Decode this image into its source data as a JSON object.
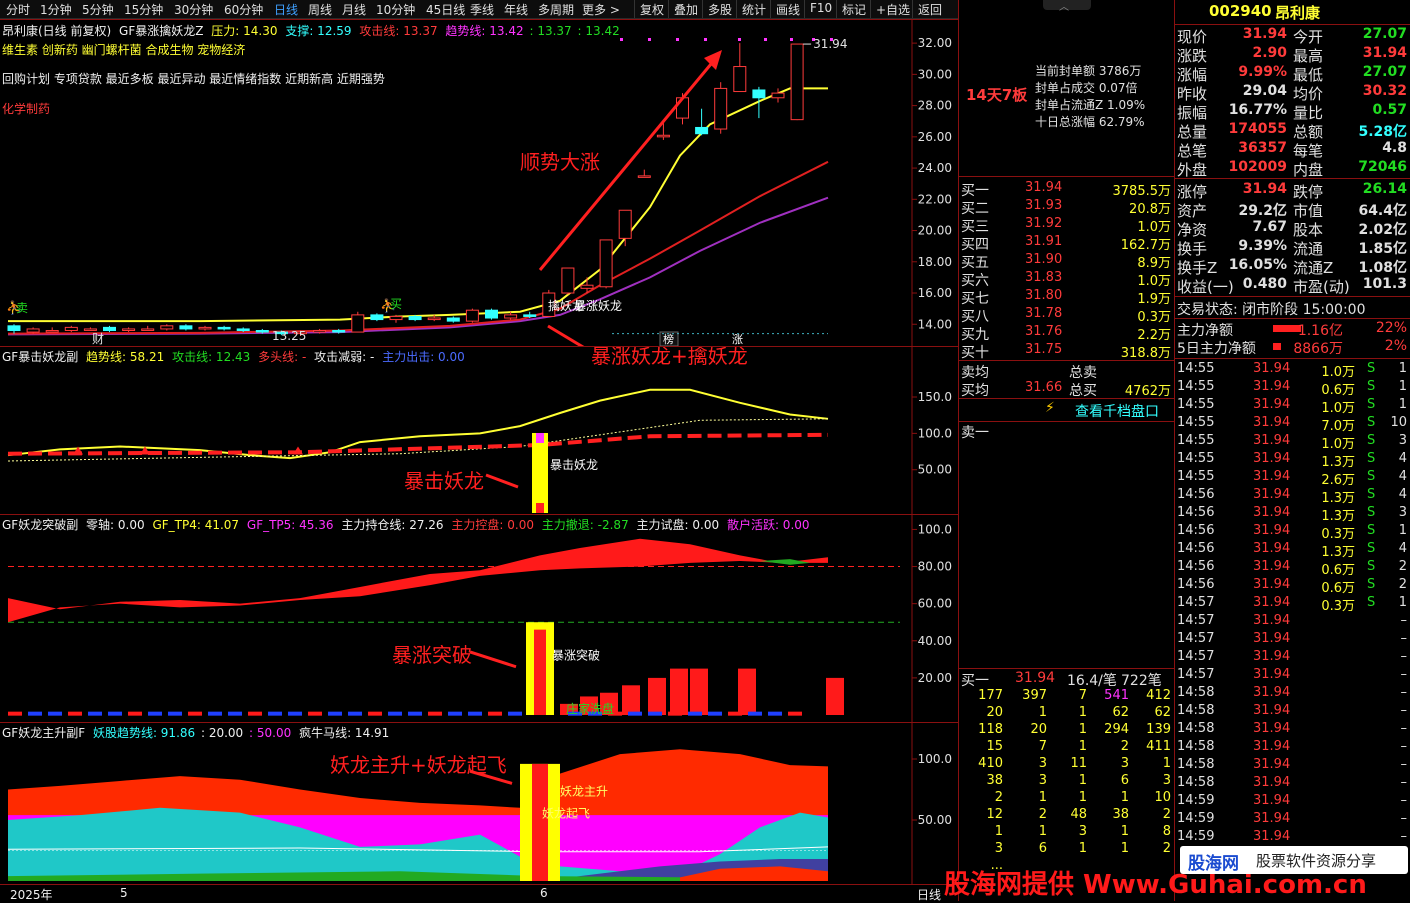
{
  "toolbar": {
    "periods": [
      "分时",
      "1分钟",
      "5分钟",
      "15分钟",
      "30分钟",
      "60分钟",
      "日线",
      "周线",
      "月线",
      "10分钟",
      "45日线",
      "季线",
      "年线",
      "多周期",
      "更多 >"
    ],
    "active_period": "日线",
    "tools": [
      "复权",
      "叠加",
      "多股",
      "统计",
      "画线",
      "F10",
      "标记",
      "+自选",
      "返回"
    ]
  },
  "main_chart": {
    "header_name": "昂利康(日线 前复权)",
    "indicator": "GF暴涨擒妖龙Z",
    "pressure_label": "压力: 14.30",
    "support_label": "支撑: 12.59",
    "attack_label": "攻击线: 13.37",
    "trend_label": "趋势线: 13.42",
    "extra1": ": 13.37",
    "extra2": ": 13.42",
    "concepts_line1": "维生素 创新药 幽门螺杆菌 合成生物 宠物经济",
    "concepts_line2": "回购计划 专项贷款 最近多板 最近异动 最近情绪指数 近期新高 近期强势",
    "industry": "化学制药",
    "y_ticks": [
      "32.00",
      "30.00",
      "28.00",
      "26.00",
      "24.00",
      "22.00",
      "20.00",
      "18.00",
      "16.00",
      "14.00"
    ],
    "high_label": "31.94",
    "low_label": "13.25",
    "sell_label": "卖",
    "buy_label": "买",
    "cai_label": "财",
    "tag_label": "擒妖龙",
    "tag_label2": "暴涨妖龙",
    "bang_label": "榜",
    "zhang_label": "涨",
    "annotation_up": "顺势大涨",
    "annotation_signal": "暴涨妖龙+擒妖龙",
    "candles": [
      {
        "o": 13.9,
        "c": 13.6,
        "h": 14.0,
        "l": 13.4
      },
      {
        "o": 13.5,
        "c": 13.7,
        "h": 13.8,
        "l": 13.4
      },
      {
        "o": 13.6,
        "c": 13.6,
        "h": 13.8,
        "l": 13.5
      },
      {
        "o": 13.6,
        "c": 13.8,
        "h": 13.9,
        "l": 13.5
      },
      {
        "o": 13.7,
        "c": 13.7,
        "h": 13.8,
        "l": 13.6
      },
      {
        "o": 13.8,
        "c": 13.6,
        "h": 13.9,
        "l": 13.5
      },
      {
        "o": 13.6,
        "c": 13.7,
        "h": 13.8,
        "l": 13.5
      },
      {
        "o": 13.7,
        "c": 13.7,
        "h": 13.9,
        "l": 13.6
      },
      {
        "o": 13.7,
        "c": 13.9,
        "h": 14.0,
        "l": 13.6
      },
      {
        "o": 13.9,
        "c": 13.7,
        "h": 14.0,
        "l": 13.6
      },
      {
        "o": 13.7,
        "c": 13.8,
        "h": 13.9,
        "l": 13.6
      },
      {
        "o": 13.8,
        "c": 13.7,
        "h": 13.9,
        "l": 13.6
      },
      {
        "o": 13.7,
        "c": 13.6,
        "h": 13.8,
        "l": 13.5
      },
      {
        "o": 13.6,
        "c": 13.5,
        "h": 13.7,
        "l": 13.4
      },
      {
        "o": 13.5,
        "c": 13.4,
        "h": 13.6,
        "l": 13.3
      },
      {
        "o": 13.4,
        "c": 13.5,
        "h": 13.6,
        "l": 13.25
      },
      {
        "o": 13.5,
        "c": 13.6,
        "h": 13.7,
        "l": 13.4
      },
      {
        "o": 13.6,
        "c": 13.5,
        "h": 13.7,
        "l": 13.4
      },
      {
        "o": 13.5,
        "c": 14.6,
        "h": 14.8,
        "l": 13.5
      },
      {
        "o": 14.6,
        "c": 14.3,
        "h": 14.7,
        "l": 14.2
      },
      {
        "o": 14.3,
        "c": 14.5,
        "h": 14.6,
        "l": 14.1
      },
      {
        "o": 14.5,
        "c": 14.3,
        "h": 14.6,
        "l": 14.2
      },
      {
        "o": 14.3,
        "c": 14.4,
        "h": 14.6,
        "l": 14.2
      },
      {
        "o": 14.4,
        "c": 14.2,
        "h": 14.5,
        "l": 14.1
      },
      {
        "o": 14.2,
        "c": 14.9,
        "h": 15.0,
        "l": 14.1
      },
      {
        "o": 14.9,
        "c": 14.4,
        "h": 15.0,
        "l": 14.3
      },
      {
        "o": 14.4,
        "c": 14.6,
        "h": 14.8,
        "l": 14.3
      },
      {
        "o": 14.6,
        "c": 14.5,
        "h": 14.8,
        "l": 14.4
      },
      {
        "o": 14.5,
        "c": 16.0,
        "h": 16.2,
        "l": 14.5
      },
      {
        "o": 16.0,
        "c": 17.6,
        "h": 17.6,
        "l": 15.9
      },
      {
        "o": 16.3,
        "c": 16.5,
        "h": 17.0,
        "l": 16.0
      },
      {
        "o": 16.4,
        "c": 19.4,
        "h": 19.4,
        "l": 16.3
      },
      {
        "o": 19.5,
        "c": 21.3,
        "h": 21.3,
        "l": 19.0
      },
      {
        "o": 23.5,
        "c": 23.5,
        "h": 23.9,
        "l": 23.4
      },
      {
        "o": 26.0,
        "c": 26.1,
        "h": 27.0,
        "l": 25.8
      },
      {
        "o": 27.2,
        "c": 28.5,
        "h": 28.8,
        "l": 26.8
      },
      {
        "o": 26.6,
        "c": 26.2,
        "h": 27.8,
        "l": 26.1
      },
      {
        "o": 26.5,
        "c": 29.1,
        "h": 29.5,
        "l": 26.2
      },
      {
        "o": 28.9,
        "c": 30.5,
        "h": 32.0,
        "l": 28.9
      },
      {
        "o": 29.0,
        "c": 28.5,
        "h": 29.2,
        "l": 27.2
      },
      {
        "o": 28.5,
        "c": 28.8,
        "h": 29.1,
        "l": 28.2
      },
      {
        "o": 27.1,
        "c": 31.94,
        "h": 31.94,
        "l": 27.07
      }
    ]
  },
  "sub1": {
    "name": "GF暴击妖龙副",
    "trend": "趋势线: 58.21",
    "attack": "攻击线: 12.43",
    "bull": "多头线: -",
    "weak": "攻击减弱: -",
    "main_out": "主力出击: 0.00",
    "y_ticks": [
      "150.0",
      "100.0",
      "50.00"
    ],
    "signal_label": "暴击妖龙",
    "annotation": "暴击妖龙"
  },
  "sub2": {
    "name": "GF妖龙突破副",
    "zero": "零轴: 0.00",
    "tp4": "GF_TP4: 41.07",
    "tp5": "GF_TP5: 45.36",
    "hold": "主力持仓线: 27.26",
    "ctrl": "主力控盘: 0.00",
    "retreat": "主力撤退: -2.87",
    "test": "主力试盘: 0.00",
    "retail": "散户活跃: 0.00",
    "y_ticks": [
      "100.0",
      "80.00",
      "60.00",
      "40.00",
      "20.00"
    ],
    "signal_label": "暴涨突破",
    "wash_label": "庄家洗盘",
    "annotation": "暴涨突破"
  },
  "sub3": {
    "name": "GF妖龙主升副F",
    "trend": "妖股趋势线: 91.86",
    "v20": ": 20.00",
    "v50": ": 50.00",
    "horse": "疯牛马线: 14.91",
    "y_ticks": [
      "100.0",
      "50.00"
    ],
    "label_main": "妖龙主升",
    "label_fly": "妖龙起飞",
    "annotation": "妖龙主升+妖龙起飞"
  },
  "date_axis": {
    "year": "2025年",
    "m5": "5",
    "m6": "6",
    "period": "日线"
  },
  "watermark": "股海网提供 Www.Guhai.com.cn",
  "watermark_logo": "股海网",
  "watermark_sub": "股票软件资源分享",
  "orderbook": {
    "limit_tag": "14天7板",
    "seal_amount": "当前封单额 3786万",
    "seal_ratio": "封单占成交 0.07倍",
    "seal_float": "封单占流通Z 1.09%",
    "ten_day": "十日总涨幅 62.79%",
    "bids": [
      [
        "买一",
        "31.94",
        "3785.5万"
      ],
      [
        "买二",
        "31.93",
        "20.8万"
      ],
      [
        "买三",
        "31.92",
        "1.0万"
      ],
      [
        "买四",
        "31.91",
        "162.7万"
      ],
      [
        "买五",
        "31.90",
        "8.9万"
      ],
      [
        "买六",
        "31.83",
        "1.0万"
      ],
      [
        "买七",
        "31.80",
        "1.9万"
      ],
      [
        "买八",
        "31.78",
        "0.3万"
      ],
      [
        "买九",
        "31.76",
        "2.2万"
      ],
      [
        "买十",
        "31.75",
        "318.8万"
      ]
    ],
    "sell_avg": "卖均",
    "total_sell": "总卖",
    "buy_avg": "买均",
    "buy_avg_val": "31.66",
    "total_buy": "总买",
    "total_buy_val": "4762万",
    "depth_link": "查看千档盘口",
    "ask1": "卖一",
    "queue_head": [
      "买一",
      "31.94",
      "16.4/笔",
      "722笔"
    ],
    "queue": [
      [
        "177",
        "397",
        "7",
        "541",
        "412"
      ],
      [
        "20",
        "1",
        "1",
        "62",
        "62"
      ],
      [
        "118",
        "20",
        "1",
        "294",
        "139"
      ],
      [
        "15",
        "7",
        "1",
        "2",
        "411"
      ],
      [
        "410",
        "3",
        "11",
        "3",
        "1"
      ],
      [
        "38",
        "3",
        "1",
        "6",
        "3"
      ],
      [
        "2",
        "1",
        "1",
        "1",
        "10"
      ],
      [
        "12",
        "2",
        "48",
        "38",
        "2"
      ],
      [
        "1",
        "1",
        "3",
        "1",
        "8"
      ],
      [
        "3",
        "6",
        "1",
        "1",
        "2"
      ],
      [
        "...",
        "",
        "",
        "",
        ""
      ]
    ]
  },
  "quotes": {
    "code": "002940",
    "name": "昂利康",
    "fields": [
      [
        "现价",
        "31.94",
        "今开",
        "27.07"
      ],
      [
        "涨跌",
        "2.90",
        "最高",
        "31.94"
      ],
      [
        "涨幅",
        "9.99%",
        "最低",
        "27.07"
      ],
      [
        "昨收",
        "29.04",
        "均价",
        "30.32"
      ],
      [
        "振幅",
        "16.77%",
        "量比",
        "0.57"
      ],
      [
        "总量",
        "174055",
        "总额",
        "5.28亿"
      ],
      [
        "总笔",
        "36357",
        "每笔",
        "4.8"
      ],
      [
        "外盘",
        "102009",
        "内盘",
        "72046"
      ]
    ],
    "fields2": [
      [
        "涨停",
        "31.94",
        "跌停",
        "26.14"
      ],
      [
        "资产",
        "29.2亿",
        "市值",
        "64.4亿"
      ],
      [
        "净资",
        "7.67",
        "股本",
        "2.02亿"
      ],
      [
        "换手",
        "9.39%",
        "流通",
        "1.85亿"
      ],
      [
        "换手Z",
        "16.05%",
        "流通Z",
        "1.08亿"
      ],
      [
        "收益(一)",
        "0.480",
        "市盈(动)",
        "101.3"
      ]
    ],
    "trade_status": "交易状态: 闭市阶段 15:00:00",
    "main_net": [
      "主力净额",
      "1.16亿",
      "22%"
    ],
    "main_net5": [
      "5日主力净额",
      "8866万",
      "2%"
    ],
    "ticks": [
      [
        "14:55",
        "31.94",
        "1.0万",
        "S",
        "1"
      ],
      [
        "14:55",
        "31.94",
        "0.6万",
        "S",
        "1"
      ],
      [
        "14:55",
        "31.94",
        "1.0万",
        "S",
        "1"
      ],
      [
        "14:55",
        "31.94",
        "7.0万",
        "S",
        "10"
      ],
      [
        "14:55",
        "31.94",
        "1.0万",
        "S",
        "3"
      ],
      [
        "14:55",
        "31.94",
        "1.3万",
        "S",
        "4"
      ],
      [
        "14:55",
        "31.94",
        "2.6万",
        "S",
        "4"
      ],
      [
        "14:56",
        "31.94",
        "1.3万",
        "S",
        "4"
      ],
      [
        "14:56",
        "31.94",
        "1.3万",
        "S",
        "3"
      ],
      [
        "14:56",
        "31.94",
        "0.3万",
        "S",
        "1"
      ],
      [
        "14:56",
        "31.94",
        "1.3万",
        "S",
        "4"
      ],
      [
        "14:56",
        "31.94",
        "0.6万",
        "S",
        "2"
      ],
      [
        "14:56",
        "31.94",
        "0.6万",
        "S",
        "2"
      ],
      [
        "14:57",
        "31.94",
        "0.3万",
        "S",
        "1"
      ],
      [
        "14:57",
        "31.94",
        "",
        "",
        "–"
      ],
      [
        "14:57",
        "31.94",
        "",
        "",
        "–"
      ],
      [
        "14:57",
        "31.94",
        "",
        "",
        "–"
      ],
      [
        "14:57",
        "31.94",
        "",
        "",
        "–"
      ],
      [
        "14:58",
        "31.94",
        "",
        "",
        "–"
      ],
      [
        "14:58",
        "31.94",
        "",
        "",
        "–"
      ],
      [
        "14:58",
        "31.94",
        "",
        "",
        "–"
      ],
      [
        "14:58",
        "31.94",
        "",
        "",
        "–"
      ],
      [
        "14:58",
        "31.94",
        "",
        "",
        "–"
      ],
      [
        "14:58",
        "31.94",
        "",
        "",
        "–"
      ],
      [
        "14:59",
        "31.94",
        "",
        "",
        "–"
      ],
      [
        "14:59",
        "31.94",
        "",
        "",
        "–"
      ],
      [
        "14:59",
        "31.94",
        "",
        "",
        "–"
      ]
    ]
  },
  "colors": {
    "up": "#ff3b3b",
    "down": "#22dd22",
    "cyan": "#33ffff",
    "yellow": "#ffff33",
    "magenta": "#ff33ff",
    "red_border": "#8a1010"
  }
}
